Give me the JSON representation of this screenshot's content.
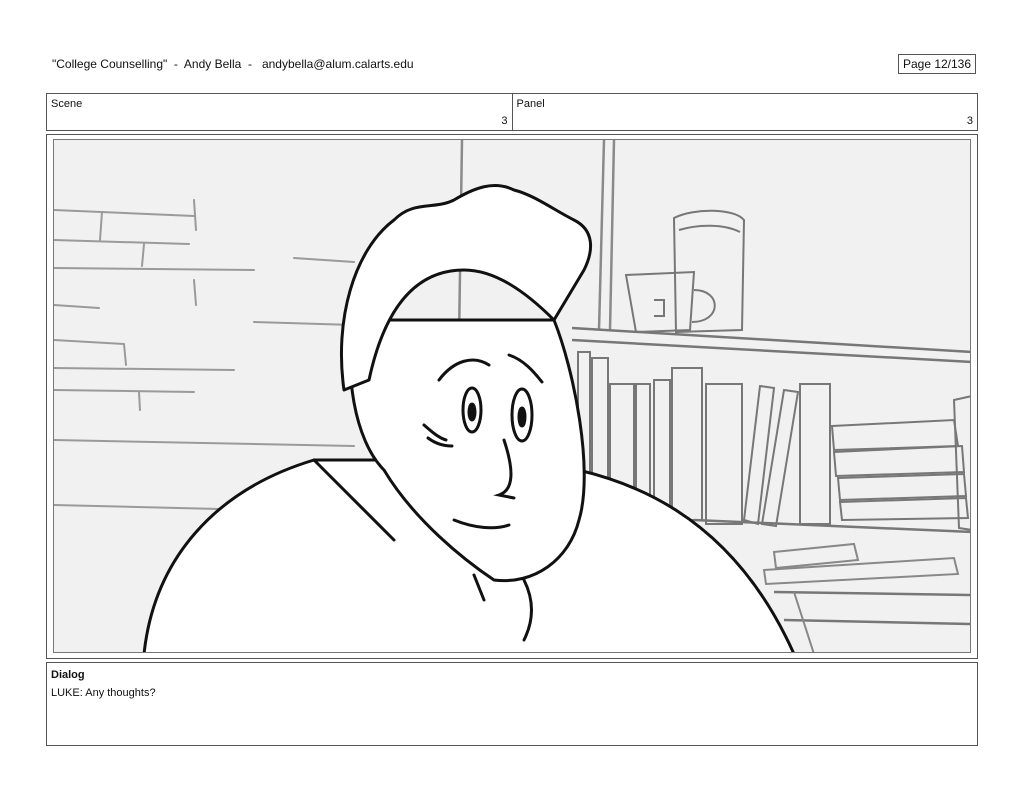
{
  "header": {
    "title": "\"College Counselling\"  -  Andy Bella  -   andybella@alum.calarts.edu",
    "page": "Page  12/136"
  },
  "meta": {
    "scene_label": "Scene",
    "scene_value": "3",
    "panel_label": "Panel",
    "panel_value": "3"
  },
  "dialog": {
    "title": "Dialog",
    "text": "LUKE: Any thoughts?"
  }
}
